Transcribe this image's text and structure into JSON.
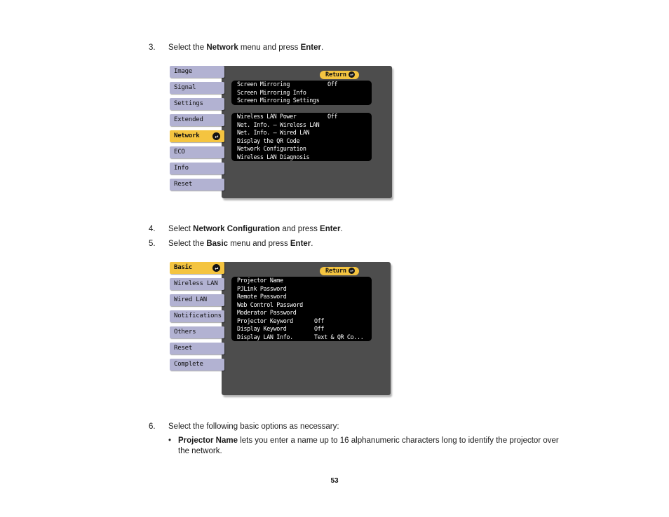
{
  "page": {
    "number": "53"
  },
  "steps": [
    {
      "num": "3.",
      "prefix": "Select the ",
      "bold1": "Network",
      "mid": " menu and press ",
      "bold2": "Enter",
      "suffix": "."
    },
    {
      "num": "4.",
      "prefix": "Select ",
      "bold1": "Network Configuration",
      "mid": " and press ",
      "bold2": "Enter",
      "suffix": "."
    },
    {
      "num": "5.",
      "prefix": "Select the ",
      "bold1": "Basic",
      "mid": " menu and press ",
      "bold2": "Enter",
      "suffix": "."
    },
    {
      "num": "6.",
      "prefix": "Select the following basic options as necessary:",
      "bold1": "",
      "mid": "",
      "bold2": "",
      "suffix": ""
    }
  ],
  "bullets": [
    {
      "dot": "•",
      "bold": "Projector Name",
      "text": " lets you enter a name up to 16 alphanumeric characters long to identify the projector over the network."
    }
  ],
  "menu_network": {
    "return_label": "Return",
    "enter_icon": "↵",
    "tabs": [
      {
        "label": "Image",
        "selected": false
      },
      {
        "label": "Signal",
        "selected": false
      },
      {
        "label": "Settings",
        "selected": false
      },
      {
        "label": "Extended",
        "selected": false
      },
      {
        "label": "Network",
        "selected": true
      },
      {
        "label": "ECO",
        "selected": false
      },
      {
        "label": "Info",
        "selected": false
      },
      {
        "label": "Reset",
        "selected": false
      }
    ],
    "groups": [
      {
        "rows": [
          {
            "label": "Screen Mirroring",
            "value": "Off"
          },
          {
            "label": "Screen Mirroring Info",
            "value": ""
          },
          {
            "label": "Screen Mirroring Settings",
            "value": ""
          }
        ]
      },
      {
        "rows": [
          {
            "label": "Wireless LAN Power",
            "value": "Off"
          },
          {
            "label": "Net. Info. – Wireless LAN",
            "value": ""
          },
          {
            "label": "Net. Info. – Wired LAN",
            "value": ""
          },
          {
            "label": "Display the QR Code",
            "value": ""
          },
          {
            "label": "Network Configuration",
            "value": ""
          },
          {
            "label": "Wireless LAN Diagnosis",
            "value": ""
          }
        ]
      }
    ]
  },
  "menu_basic": {
    "return_label": "Return",
    "enter_icon": "↵",
    "tabs": [
      {
        "label": "Basic",
        "selected": true
      },
      {
        "label": "Wireless LAN",
        "selected": false
      },
      {
        "label": "Wired LAN",
        "selected": false
      },
      {
        "label": "Notifications",
        "selected": false
      },
      {
        "label": "Others",
        "selected": false
      },
      {
        "label": "Reset",
        "selected": false
      },
      {
        "label": "Complete",
        "selected": false
      }
    ],
    "groups": [
      {
        "rows": [
          {
            "label": "Projector Name",
            "value": ""
          },
          {
            "label": "PJLink Password",
            "value": ""
          },
          {
            "label": "Remote Password",
            "value": ""
          },
          {
            "label": "Web Control Password",
            "value": ""
          },
          {
            "label": "Moderator Password",
            "value": ""
          },
          {
            "label": "Projector Keyword",
            "value": "Off"
          },
          {
            "label": "Display Keyword",
            "value": "Off"
          },
          {
            "label": "Display LAN Info.",
            "value": "Text & QR Co..."
          }
        ]
      }
    ]
  },
  "colors": {
    "tab_unselected": "#b2b2d2",
    "tab_selected": "#f4c440",
    "panel_bg": "#4d4d4d",
    "list_bg": "#000000",
    "accent": "#f4c440"
  }
}
